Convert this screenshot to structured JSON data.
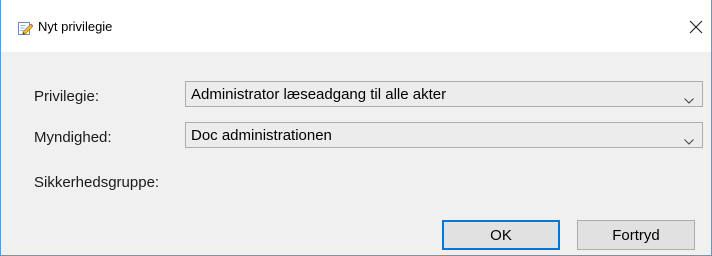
{
  "window": {
    "title": "Nyt privilegie",
    "icon": "edit-document-icon",
    "close_icon": "close-icon"
  },
  "form": {
    "privilege": {
      "label": "Privilegie:",
      "value": "Administrator læseadgang til alle akter"
    },
    "authority": {
      "label": "Myndighed:",
      "value": "Doc administrationen"
    },
    "security_group": {
      "label": "Sikkerhedsgruppe:"
    }
  },
  "buttons": {
    "ok_label": "OK",
    "cancel_label": "Fortryd"
  },
  "colors": {
    "window_border": "#5a9bd5",
    "dialog_background": "#f0f0f0",
    "default_button_border": "#0078d7"
  }
}
